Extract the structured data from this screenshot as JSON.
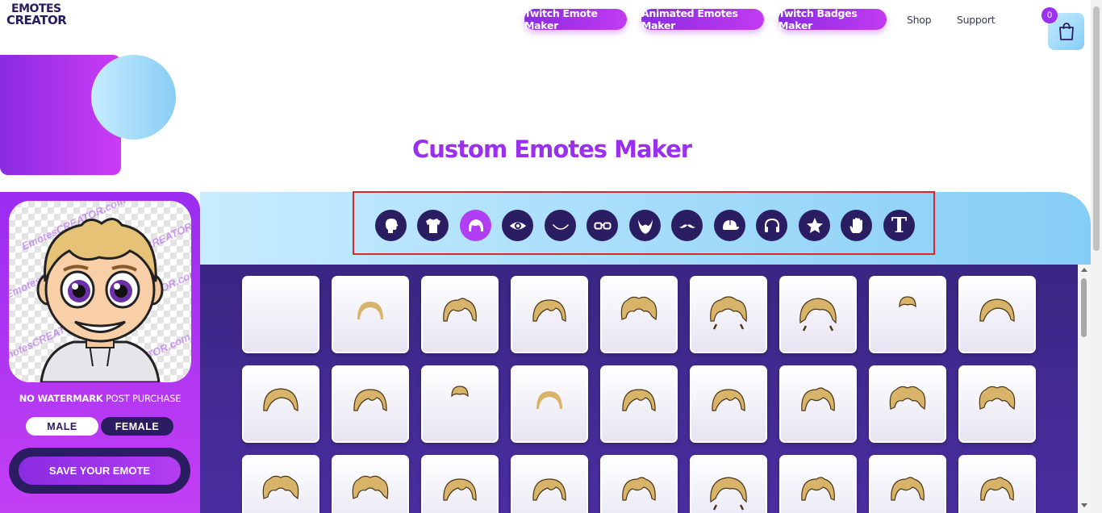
{
  "logo": {
    "line1": "EMOTES",
    "line2": "CREATOR"
  },
  "nav": {
    "twitch_emote_maker": "Twitch Emote Maker",
    "animated_emotes_maker": "Animated Emotes Maker",
    "twitch_badges_maker": "Twitch Badges Maker",
    "shop": "Shop",
    "support": "Support"
  },
  "cart": {
    "count": "0",
    "icon": "shopping-bag-icon"
  },
  "hero": {
    "title": "Custom Emotes Maker"
  },
  "preview": {
    "watermark": "EmotesCREATOR.com"
  },
  "left_panel": {
    "watermark_note_bold": "NO WATERMARK",
    "watermark_note_rest": " POST PURCHASE",
    "male_label": "MALE",
    "female_label": "FEMALE",
    "save_label": "SAVE YOUR EMOTE"
  },
  "categories": [
    {
      "icon": "head-icon",
      "active": false
    },
    {
      "icon": "shirt-icon",
      "active": false
    },
    {
      "icon": "hair-icon",
      "active": true
    },
    {
      "icon": "eye-icon",
      "active": false
    },
    {
      "icon": "mouth-icon",
      "active": false
    },
    {
      "icon": "glasses-icon",
      "active": false
    },
    {
      "icon": "beard-icon",
      "active": false
    },
    {
      "icon": "mustache-icon",
      "active": false
    },
    {
      "icon": "cap-icon",
      "active": false
    },
    {
      "icon": "headphones-icon",
      "active": false
    },
    {
      "icon": "star-icon",
      "active": false
    },
    {
      "icon": "hand-icon",
      "active": false
    },
    {
      "icon": "text-icon",
      "active": false
    }
  ],
  "category_text_glyph": "T",
  "colors": {
    "accent_purple": "#9a2ff0",
    "dark_navy": "#2a1d62",
    "hair_blonde": "#d8b46a",
    "highlight_red": "#e0262a"
  }
}
